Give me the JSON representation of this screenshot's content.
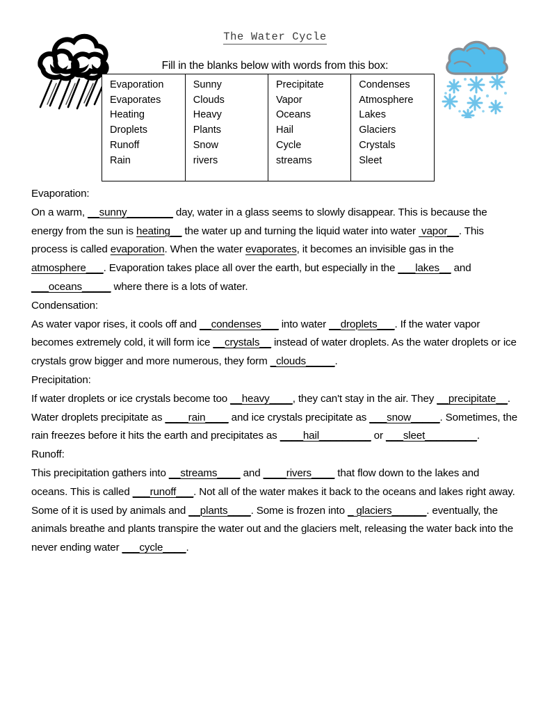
{
  "document": {
    "title": "The Water Cycle",
    "instruction": "Fill in the blanks below with words from this box:"
  },
  "wordbox": {
    "columns": [
      {
        "words": [
          "Evaporation",
          "Evaporates",
          "Heating",
          "Droplets",
          "Runoff",
          "Rain"
        ]
      },
      {
        "words": [
          "Sunny",
          "Clouds",
          "Heavy",
          "Plants",
          "Snow",
          "rivers"
        ]
      },
      {
        "words": [
          "Precipitate",
          "Vapor",
          "Oceans",
          "Hail",
          "Cycle",
          "streams"
        ]
      },
      {
        "words": [
          "Condenses",
          "Atmosphere",
          "Lakes",
          "Glaciers",
          "Crystals",
          "Sleet"
        ]
      }
    ]
  },
  "sections": {
    "evaporation": {
      "heading": "Evaporation:",
      "t1": "On a warm, ",
      "a1": "__sunny________",
      "t2": " day, water in a glass seems to slowly disappear.  This is because the energy from the sun is ",
      "a2": "heating__",
      "t3": " the water up and turning the liquid water into water ",
      "a3": " vapor__",
      "t4": ".  This process is called ",
      "u1": "evaporation",
      "t5": ".  When the water ",
      "u2": "evaporates",
      "t6": ", it becomes an invisible gas in the ",
      "a4": "atmosphere___",
      "t7": ".  Evaporation takes place all over the earth, but especially in the ",
      "a5": "___lakes__",
      "t8": " and ",
      "a6": "___oceans_____",
      "t9": " where there is a lots of water."
    },
    "condensation": {
      "heading": "Condensation:",
      "t1": "As water vapor rises, it cools off and ",
      "a1": "__condenses___",
      "t2": " into water ",
      "a2": "__droplets___",
      "t3": ".  If the water vapor becomes extremely cold, it will form ice ",
      "a3": "__crystals__",
      "t4": " instead of water droplets.  As the water droplets or ice crystals grow bigger and more numerous, they form ",
      "a4": "_clouds_____",
      "t5": "."
    },
    "precipitation": {
      "heading": "Precipitation:",
      "t1": "If water droplets or ice crystals become too ",
      "a1": "__heavy____",
      "t2": ", they can't stay in the air.  They ",
      "a2": "__precipitate",
      "a2b": "__",
      "t3": ".  Water droplets precipitate as ",
      "a3": "____rain____",
      "t4": " and ice crystals precipitate as ",
      "a4": "___snow_____",
      "t5": ".  Sometimes, the rain freezes before it hits the earth and precipitates as ",
      "a5": "____hail_________",
      "t6": " or ",
      "a6": "___sleet_________",
      "t7": "."
    },
    "runoff": {
      "heading": "Runoff:",
      "t1": "This precipitation gathers into ",
      "a1": "__streams____",
      "t2": " and ",
      "a2": "____rivers____",
      "t3": " that flow down to the lakes and oceans.  This is called ",
      "a3": "___runoff___",
      "t4": ".  Not all of the water makes it back to the oceans and lakes right away.  Some of it is used by animals and ",
      "a4": "__plants____",
      "t5": ".  Some is frozen into ",
      "a5": "_ glaciers______",
      "t6": ". eventually, the animals breathe and plants transpire the water out and the glaciers melt, releasing the water back into the never ending water ",
      "a6": "___cycle____",
      "t7": "."
    }
  },
  "artwork": {
    "rain_cloud": "rain-cloud-clipart",
    "snow_cloud": "snow-cloud-clipart",
    "snow_cloud_fill": "#52bdec",
    "snow_cloud_outline": "#8a8d92",
    "snowflake_color": "#6ec3ea"
  }
}
